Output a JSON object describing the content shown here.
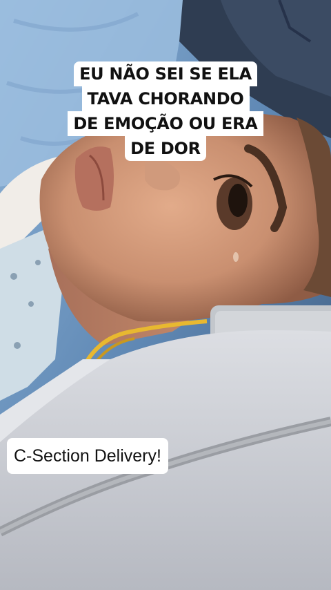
{
  "caption": {
    "lines": [
      "EU NÃO SEI SE ELA",
      "TAVA CHORANDO",
      "DE EMOÇÃO OU ERA",
      "DE DOR"
    ]
  },
  "label": {
    "text": "C-Section Delivery!"
  },
  "colors": {
    "caption_bg": "#ffffff",
    "caption_text": "#111111",
    "drape": "#c9ccd3",
    "scrubs": "#2f3d52",
    "skin": "#c98f70"
  }
}
